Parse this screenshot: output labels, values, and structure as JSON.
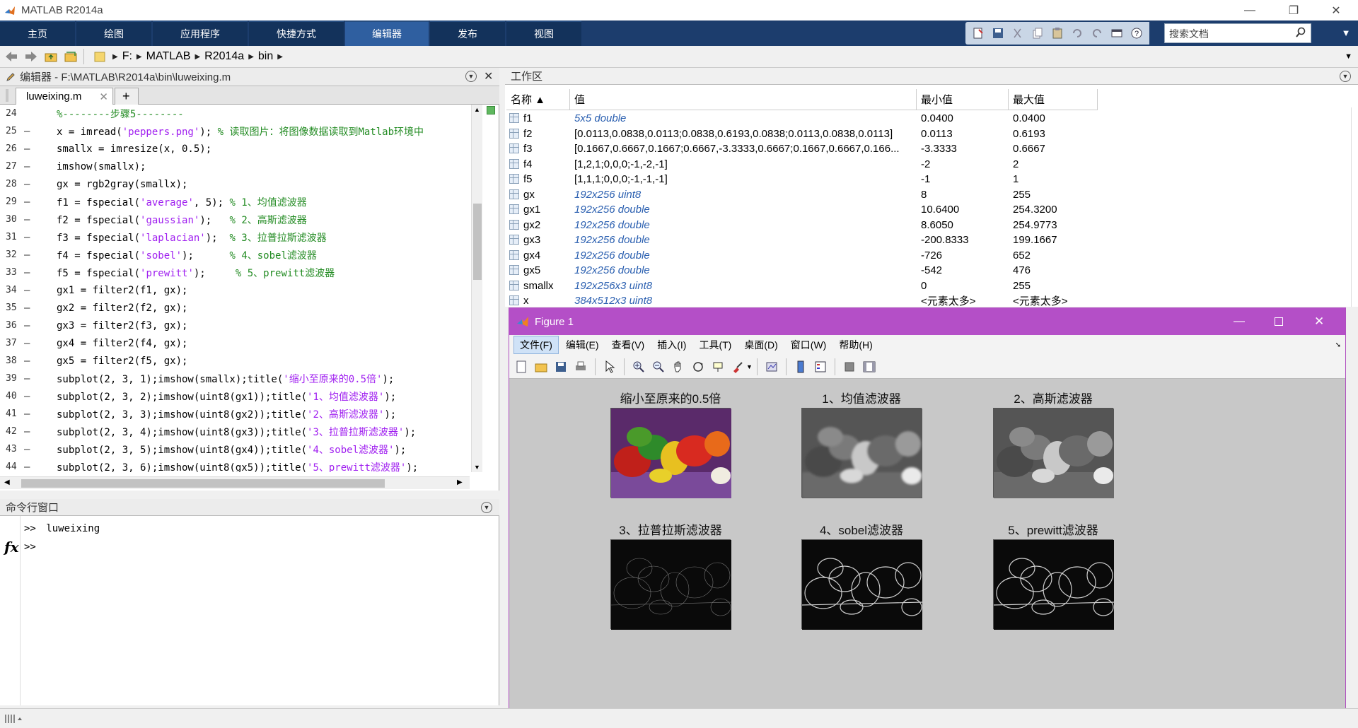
{
  "app": {
    "title": "MATLAB R2014a"
  },
  "window_controls": {
    "minimize": "—",
    "restore": "❐",
    "close": "✕"
  },
  "ribbon": {
    "tabs": [
      "主页",
      "绘图",
      "应用程序",
      "快捷方式",
      "编辑器",
      "发布",
      "视图"
    ],
    "active_tab": "编辑器",
    "search_placeholder": "搜索文档"
  },
  "address": {
    "crumbs": [
      "F:",
      "MATLAB",
      "R2014a",
      "bin"
    ]
  },
  "editor": {
    "header": "编辑器 - F:\\MATLAB\\R2014a\\bin\\luweixing.m",
    "tab_label": "luweixing.m",
    "add_tab": "+",
    "lines": [
      {
        "n": "24",
        "dash": "",
        "parts": [
          {
            "t": "%--------步骤5--------",
            "c": "cm"
          }
        ]
      },
      {
        "n": "25",
        "dash": "—",
        "parts": [
          {
            "t": "x = imread(",
            "c": ""
          },
          {
            "t": "'peppers.png'",
            "c": "st"
          },
          {
            "t": "); ",
            "c": ""
          },
          {
            "t": "% 读取图片：将图像数据读取到Matlab环境中",
            "c": "cm"
          }
        ]
      },
      {
        "n": "26",
        "dash": "—",
        "parts": [
          {
            "t": "smallx = imresize(x, 0.5);",
            "c": ""
          }
        ]
      },
      {
        "n": "27",
        "dash": "—",
        "parts": [
          {
            "t": "imshow(smallx);",
            "c": ""
          }
        ]
      },
      {
        "n": "28",
        "dash": "—",
        "parts": [
          {
            "t": "gx = rgb2gray(smallx);",
            "c": ""
          }
        ]
      },
      {
        "n": "29",
        "dash": "—",
        "parts": [
          {
            "t": "f1 = fspecial(",
            "c": ""
          },
          {
            "t": "'average'",
            "c": "st"
          },
          {
            "t": ", 5); ",
            "c": ""
          },
          {
            "t": "% 1、均值滤波器",
            "c": "cm"
          }
        ]
      },
      {
        "n": "30",
        "dash": "—",
        "parts": [
          {
            "t": "f2 = fspecial(",
            "c": ""
          },
          {
            "t": "'gaussian'",
            "c": "st"
          },
          {
            "t": ");   ",
            "c": ""
          },
          {
            "t": "% 2、高斯滤波器",
            "c": "cm"
          }
        ]
      },
      {
        "n": "31",
        "dash": "—",
        "parts": [
          {
            "t": "f3 = fspecial(",
            "c": ""
          },
          {
            "t": "'laplacian'",
            "c": "st"
          },
          {
            "t": ");  ",
            "c": ""
          },
          {
            "t": "% 3、拉普拉斯滤波器",
            "c": "cm"
          }
        ]
      },
      {
        "n": "32",
        "dash": "—",
        "parts": [
          {
            "t": "f4 = fspecial(",
            "c": ""
          },
          {
            "t": "'sobel'",
            "c": "st"
          },
          {
            "t": ");      ",
            "c": ""
          },
          {
            "t": "% 4、sobel滤波器",
            "c": "cm"
          }
        ]
      },
      {
        "n": "33",
        "dash": "—",
        "parts": [
          {
            "t": "f5 = fspecial(",
            "c": ""
          },
          {
            "t": "'prewitt'",
            "c": "st"
          },
          {
            "t": ");     ",
            "c": ""
          },
          {
            "t": "% 5、prewitt滤波器",
            "c": "cm"
          }
        ]
      },
      {
        "n": "34",
        "dash": "—",
        "parts": [
          {
            "t": "gx1 = filter2(f1, gx);",
            "c": ""
          }
        ]
      },
      {
        "n": "35",
        "dash": "—",
        "parts": [
          {
            "t": "gx2 = filter2(f2, gx);",
            "c": ""
          }
        ]
      },
      {
        "n": "36",
        "dash": "—",
        "parts": [
          {
            "t": "gx3 = filter2(f3, gx);",
            "c": ""
          }
        ]
      },
      {
        "n": "37",
        "dash": "—",
        "parts": [
          {
            "t": "gx4 = filter2(f4, gx);",
            "c": ""
          }
        ]
      },
      {
        "n": "38",
        "dash": "—",
        "parts": [
          {
            "t": "gx5 = filter2(f5, gx);",
            "c": ""
          }
        ]
      },
      {
        "n": "39",
        "dash": "—",
        "parts": [
          {
            "t": "subplot(2, 3, 1);imshow(smallx);title(",
            "c": ""
          },
          {
            "t": "'缩小至原来的0.5倍'",
            "c": "st"
          },
          {
            "t": ");",
            "c": ""
          }
        ]
      },
      {
        "n": "40",
        "dash": "—",
        "parts": [
          {
            "t": "subplot(2, 3, 2);imshow(uint8(gx1));title(",
            "c": ""
          },
          {
            "t": "'1、均值滤波器'",
            "c": "st"
          },
          {
            "t": ");",
            "c": ""
          }
        ]
      },
      {
        "n": "41",
        "dash": "—",
        "parts": [
          {
            "t": "subplot(2, 3, 3);imshow(uint8(gx2));title(",
            "c": ""
          },
          {
            "t": "'2、高斯滤波器'",
            "c": "st"
          },
          {
            "t": ");",
            "c": ""
          }
        ]
      },
      {
        "n": "42",
        "dash": "—",
        "parts": [
          {
            "t": "subplot(2, 3, 4);imshow(uint8(gx3));title(",
            "c": ""
          },
          {
            "t": "'3、拉普拉斯滤波器'",
            "c": "st"
          },
          {
            "t": ");",
            "c": ""
          }
        ]
      },
      {
        "n": "43",
        "dash": "—",
        "parts": [
          {
            "t": "subplot(2, 3, 5);imshow(uint8(gx4));title(",
            "c": ""
          },
          {
            "t": "'4、sobel滤波器'",
            "c": "st"
          },
          {
            "t": ");",
            "c": ""
          }
        ]
      },
      {
        "n": "44",
        "dash": "—",
        "parts": [
          {
            "t": "subplot(2, 3, 6);imshow(uint8(gx5));title(",
            "c": ""
          },
          {
            "t": "'5、prewitt滤波器'",
            "c": "st"
          },
          {
            "t": ");",
            "c": ""
          }
        ]
      }
    ]
  },
  "command_window": {
    "header": "命令行窗口",
    "history_prompt": ">>",
    "history_cmd": "luweixing",
    "prompt": ">>",
    "fx": "fx"
  },
  "workspace": {
    "header": "工作区",
    "columns": [
      "名称 ▲",
      "值",
      "最小值",
      "最大值"
    ],
    "rows": [
      {
        "name": "f1",
        "value": "5x5 double",
        "italic": true,
        "min": "0.0400",
        "max": "0.0400"
      },
      {
        "name": "f2",
        "value": "[0.0113,0.0838,0.0113;0.0838,0.6193,0.0838;0.0113,0.0838,0.0113]",
        "italic": false,
        "min": "0.0113",
        "max": "0.6193"
      },
      {
        "name": "f3",
        "value": "[0.1667,0.6667,0.1667;0.6667,-3.3333,0.6667;0.1667,0.6667,0.166...",
        "italic": false,
        "min": "-3.3333",
        "max": "0.6667"
      },
      {
        "name": "f4",
        "value": "[1,2,1;0,0,0;-1,-2,-1]",
        "italic": false,
        "min": "-2",
        "max": "2"
      },
      {
        "name": "f5",
        "value": "[1,1,1;0,0,0;-1,-1,-1]",
        "italic": false,
        "min": "-1",
        "max": "1"
      },
      {
        "name": "gx",
        "value": "192x256 uint8",
        "italic": true,
        "min": "8",
        "max": "255"
      },
      {
        "name": "gx1",
        "value": "192x256 double",
        "italic": true,
        "min": "10.6400",
        "max": "254.3200"
      },
      {
        "name": "gx2",
        "value": "192x256 double",
        "italic": true,
        "min": "8.6050",
        "max": "254.9773"
      },
      {
        "name": "gx3",
        "value": "192x256 double",
        "italic": true,
        "min": "-200.8333",
        "max": "199.1667"
      },
      {
        "name": "gx4",
        "value": "192x256 double",
        "italic": true,
        "min": "-726",
        "max": "652"
      },
      {
        "name": "gx5",
        "value": "192x256 double",
        "italic": true,
        "min": "-542",
        "max": "476"
      },
      {
        "name": "smallx",
        "value": "192x256x3 uint8",
        "italic": true,
        "min": "0",
        "max": "255"
      },
      {
        "name": "x",
        "value": "384x512x3 uint8",
        "italic": true,
        "min": "<元素太多>",
        "max": "<元素太多>"
      }
    ]
  },
  "figure": {
    "title": "Figure 1",
    "menu": [
      "文件(F)",
      "编辑(E)",
      "查看(V)",
      "插入(I)",
      "工具(T)",
      "桌面(D)",
      "窗口(W)",
      "帮助(H)"
    ],
    "subplots": [
      {
        "title": "缩小至原来的0.5倍",
        "kind": "color"
      },
      {
        "title": "1、均值滤波器",
        "kind": "blur"
      },
      {
        "title": "2、高斯滤波器",
        "kind": "gray"
      },
      {
        "title": "3、拉普拉斯滤波器",
        "kind": "lap"
      },
      {
        "title": "4、sobel滤波器",
        "kind": "sobel"
      },
      {
        "title": "5、prewitt滤波器",
        "kind": "prewitt"
      }
    ]
  },
  "colors": {
    "ribbon": "#1c3d6d",
    "figure_title": "#b44fc7",
    "comment": "#228b22",
    "string": "#a020f0"
  }
}
